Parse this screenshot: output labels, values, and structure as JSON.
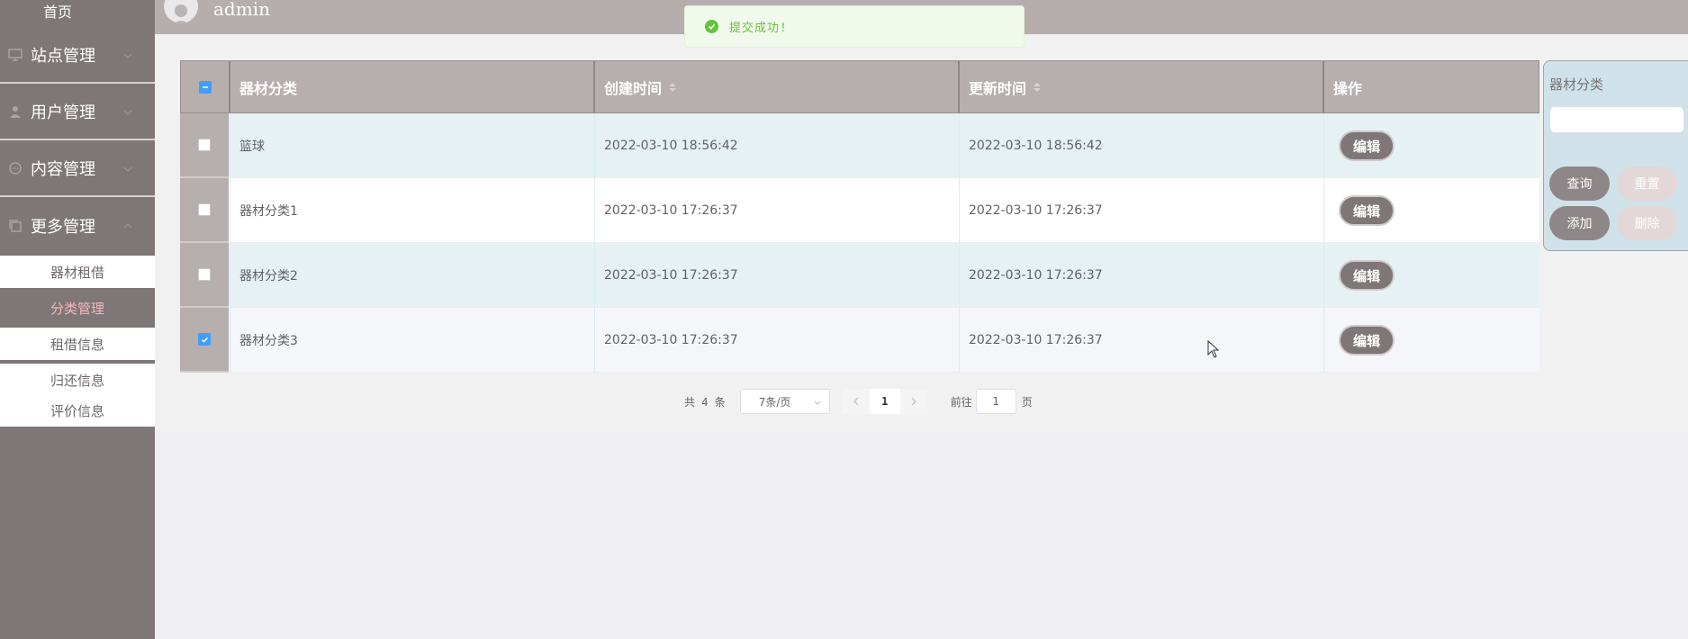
{
  "sidebar": {
    "home": "首页",
    "menus": [
      {
        "label": "站点管理",
        "icon": "monitor-icon"
      },
      {
        "label": "用户管理",
        "icon": "user-icon"
      },
      {
        "label": "内容管理",
        "icon": "chat-icon"
      },
      {
        "label": "更多管理",
        "icon": "copy-icon"
      }
    ],
    "submenu": [
      {
        "label": "器材租借",
        "active": false
      },
      {
        "label": "分类管理",
        "active": true
      },
      {
        "label": "租借信息",
        "active": false
      },
      {
        "label": "归还信息",
        "active": false
      },
      {
        "label": "评价信息",
        "active": false
      }
    ]
  },
  "header": {
    "username": "admin"
  },
  "toast": {
    "message": "提交成功!"
  },
  "table": {
    "headers": {
      "category": "器材分类",
      "created": "创建时间",
      "updated": "更新时间",
      "actions": "操作"
    },
    "rows": [
      {
        "category": "篮球",
        "created": "2022-03-10 18:56:42",
        "updated": "2022-03-10 18:56:42",
        "checked": false,
        "action": "编辑"
      },
      {
        "category": "器材分类1",
        "created": "2022-03-10 17:26:37",
        "updated": "2022-03-10 17:26:37",
        "checked": false,
        "action": "编辑"
      },
      {
        "category": "器材分类2",
        "created": "2022-03-10 17:26:37",
        "updated": "2022-03-10 17:26:37",
        "checked": false,
        "action": "编辑"
      },
      {
        "category": "器材分类3",
        "created": "2022-03-10 17:26:37",
        "updated": "2022-03-10 17:26:37",
        "checked": true,
        "action": "编辑"
      }
    ]
  },
  "pagination": {
    "total": "共 4 条",
    "page_size": "7条/页",
    "current_page": "1",
    "goto_label": "前往",
    "goto_value": "1",
    "page_unit": "页"
  },
  "search_panel": {
    "label": "器材分类",
    "input_value": "",
    "query": "查询",
    "reset": "重置",
    "add": "添加",
    "delete": "删除"
  },
  "colors": {
    "sidebar": "#7f7777",
    "header": "#b6adad",
    "active_sub": "#f5b8b8",
    "success": "#67c23a",
    "checkbox": "#409eff"
  }
}
